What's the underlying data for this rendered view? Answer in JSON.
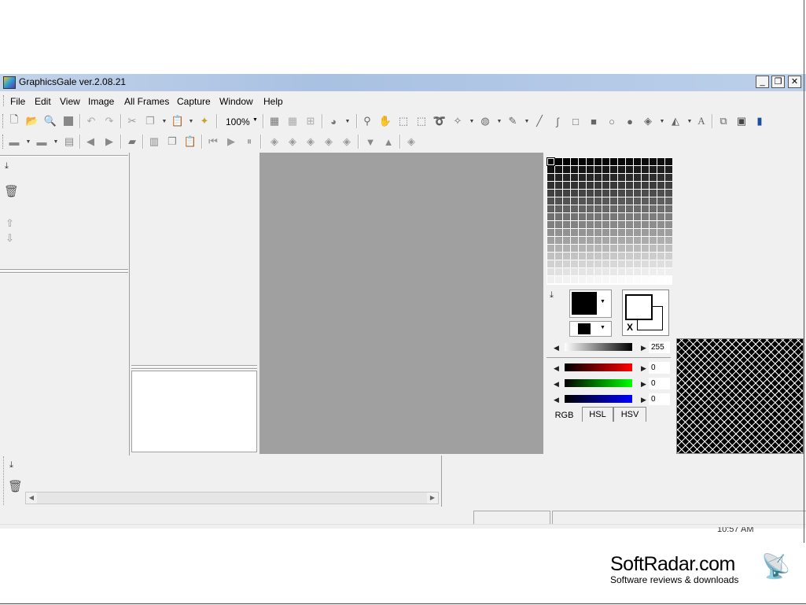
{
  "window": {
    "title": "GraphicsGale ver.2.08.21",
    "min_label": "_",
    "max_label": "❐",
    "close_label": "✕"
  },
  "menu": [
    {
      "label": "File"
    },
    {
      "label": "Edit"
    },
    {
      "label": "View"
    },
    {
      "label": "Image"
    },
    {
      "label": "All Frames"
    },
    {
      "label": "Capture"
    },
    {
      "label": "Window"
    },
    {
      "label": "Help"
    }
  ],
  "toolbar1": {
    "zoom": "100%"
  },
  "color_panel": {
    "alpha_value": "255",
    "r_value": "0",
    "g_value": "0",
    "b_value": "0",
    "swap_label": "X",
    "tabs": [
      "RGB",
      "HSL",
      "HSV"
    ],
    "active_tab": "RGB"
  },
  "statusbar": {
    "clock": "10:57 AM"
  },
  "watermark": {
    "brand": "SoftRadar.com",
    "tagline": "Software reviews & downloads"
  },
  "colors": {
    "title_gradient": "#a9c1e2",
    "canvas": "#a0a0a0",
    "panel": "#f0f0f0"
  }
}
